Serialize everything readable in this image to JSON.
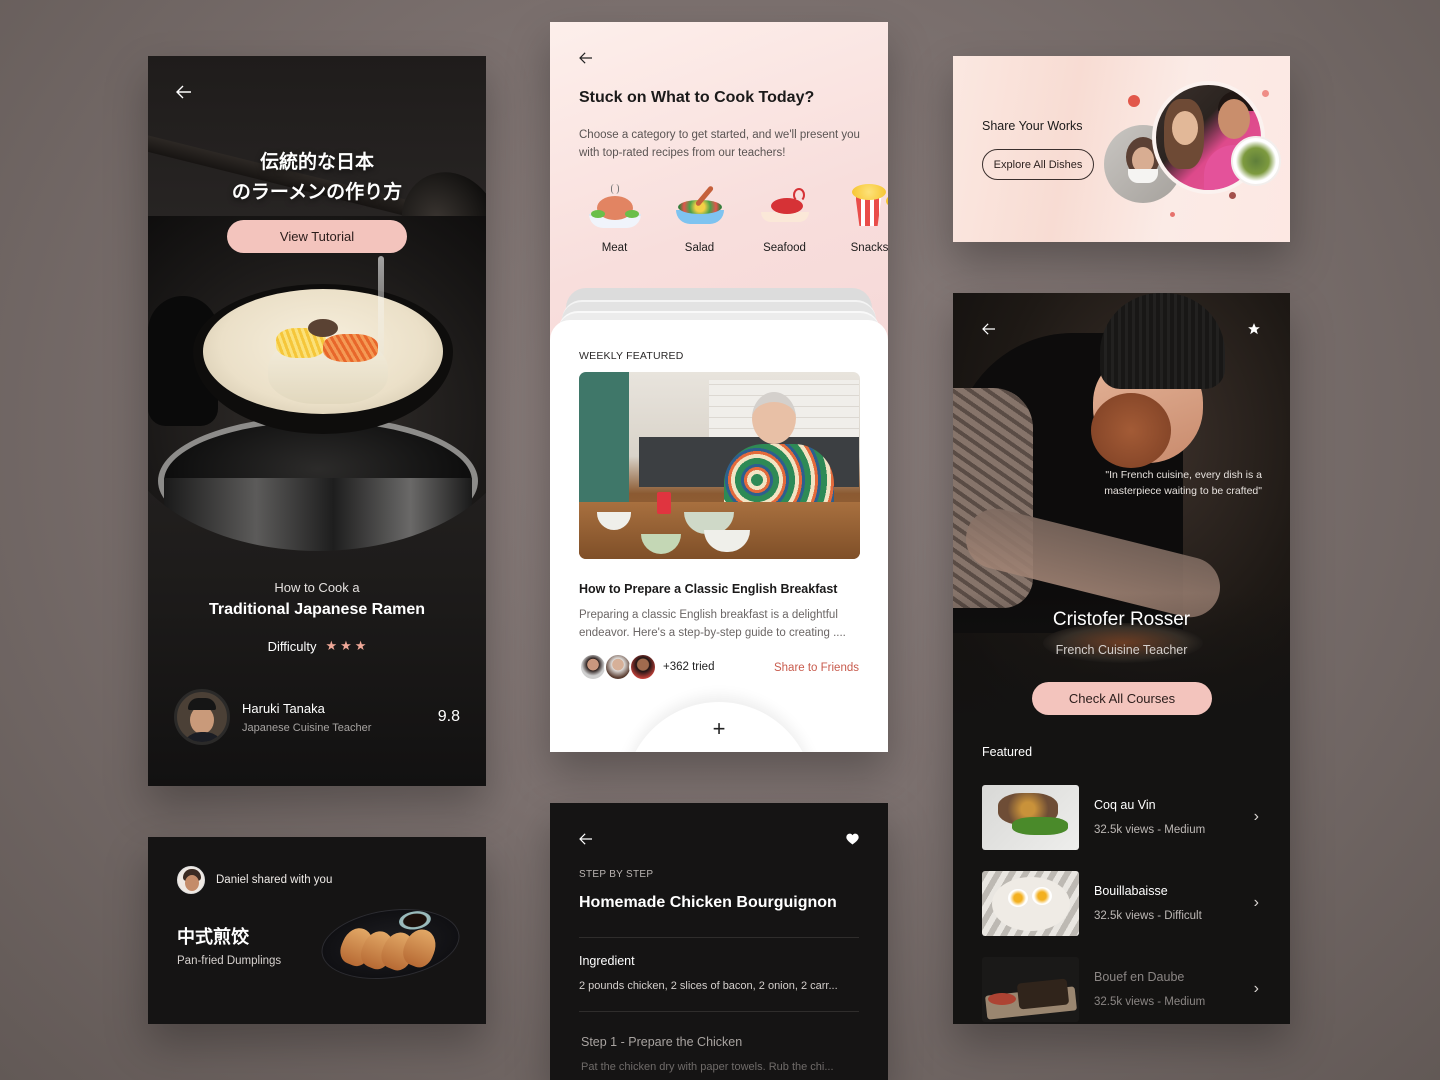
{
  "colors": {
    "accent_pink": "#f3c4bd",
    "share_link": "#c85b4d",
    "star": "#f0a898",
    "dark_card": "#161515"
  },
  "ramen_card": {
    "back_icon": "arrow-left-icon",
    "hero_title": "伝統的な日本\nのラーメンの作り方",
    "cta_label": "View Tutorial",
    "subtitle": "How to Cook a",
    "title": "Traditional Japanese Ramen",
    "difficulty_label": "Difficulty",
    "difficulty_rating": 3,
    "difficulty_max": 3,
    "teacher": {
      "name": "Haruki Tanaka",
      "role": "Japanese Cuisine Teacher",
      "score": "9.8"
    }
  },
  "discover_card": {
    "back_icon": "arrow-left-icon",
    "title": "Stuck on What to Cook Today?",
    "description": "Choose a category to get started, and we'll present you with top-rated recipes from our teachers!",
    "categories": [
      {
        "label": "Meat",
        "icon": "roast-chicken-icon"
      },
      {
        "label": "Salad",
        "icon": "salad-bowl-icon"
      },
      {
        "label": "Seafood",
        "icon": "lobster-icon"
      },
      {
        "label": "Snacks",
        "icon": "popcorn-icon"
      }
    ],
    "weekly_label": "WEEKLY FEATURED",
    "featured": {
      "title": "How to Prepare a Classic English Breakfast",
      "description": "Preparing a classic English breakfast is a delightful endeavor. Here's a step-by-step guide to creating ....",
      "tried_count": "+362 tried",
      "share_label": "Share to Friends"
    },
    "fab_label": "+"
  },
  "share_works_card": {
    "label": "Share Your Works",
    "button_label": "Explore All Dishes"
  },
  "teacher_card": {
    "back_icon": "arrow-left-icon",
    "favorite_icon": "star-icon",
    "quote": "\"In French cuisine, every dish is a masterpiece waiting to be crafted\"",
    "name": "Cristofer Rosser",
    "role": "French Cuisine Teacher",
    "cta_label": "Check All Courses",
    "featured_label": "Featured",
    "featured_items": [
      {
        "title": "Coq au Vin",
        "meta": "32.5k views - Medium"
      },
      {
        "title": "Bouillabaisse",
        "meta": "32.5k views - Difficult"
      },
      {
        "title": "Bouef en Daube",
        "meta": "32.5k views - Medium"
      }
    ]
  },
  "shared_card": {
    "shared_text": "Daniel shared with you",
    "dish_cn": "中式煎饺",
    "dish_en": "Pan-fried Dumplings"
  },
  "steps_card": {
    "back_icon": "arrow-left-icon",
    "favorite_icon": "heart-icon",
    "kicker": "STEP BY STEP",
    "title": "Homemade Chicken Bourguignon",
    "ingredient_label": "Ingredient",
    "ingredient_text": "2 pounds chicken, 2 slices of bacon, 2 onion, 2 carr...",
    "step_title": "Step 1 - Prepare the Chicken",
    "step_text": "Pat the chicken dry with paper towels. Rub the chi..."
  }
}
